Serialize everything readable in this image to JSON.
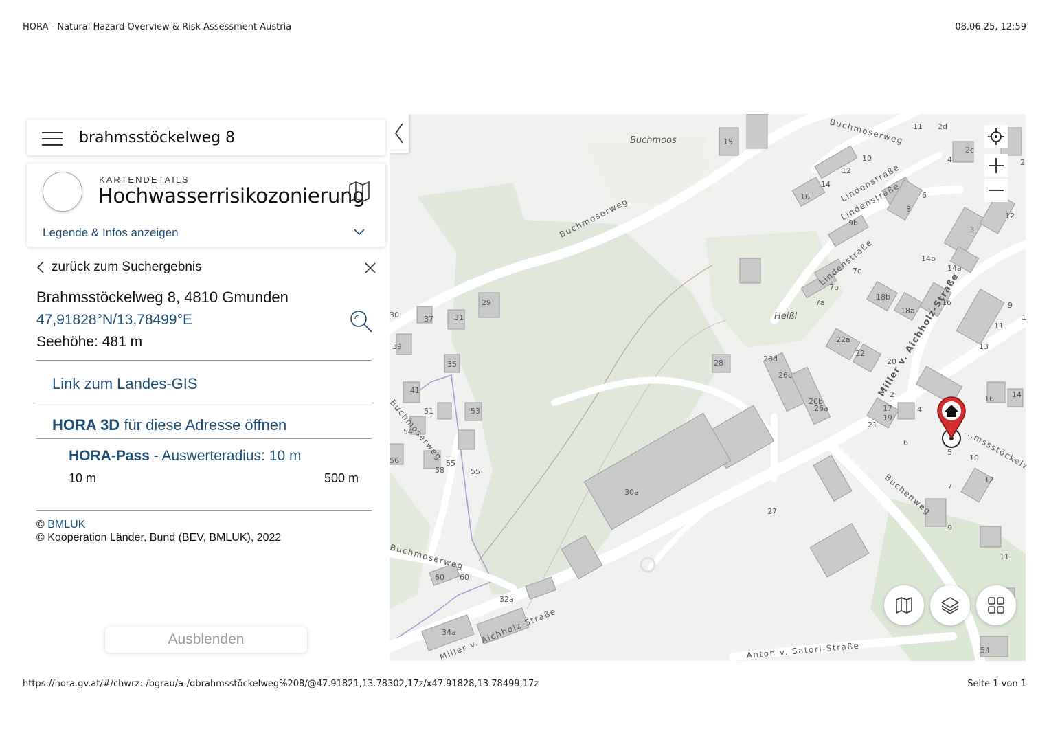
{
  "print_header": {
    "title": "HORA - Natural Hazard Overview & Risk Assessment Austria",
    "datetime": "08.06.25, 12:59"
  },
  "print_footer": {
    "url": "https://hora.gv.at/#/chwrz:-/bgrau/a-/qbrahmsstöckelweg%208/@47.91821,13.78302,17z/x47.91828,13.78499,17z",
    "page": "Seite 1 von 1"
  },
  "search": {
    "value": "brahmsstöckelweg 8"
  },
  "card": {
    "kicker": "KARTENDETAILS",
    "title": "Hochwasserrisikozonierung",
    "legend_label": "Legende & Infos anzeigen"
  },
  "result": {
    "back_label": "zurück zum Suchergebnis",
    "address": "Brahmsstöckelweg 8, 4810 Gmunden",
    "coords": "47,91828°N/13,78499°E",
    "altitude": "Seehöhe: 481 m",
    "landes_gis_link": "Link zum Landes-GIS",
    "hora3d_bold": "HORA 3D",
    "hora3d_rest": " für diese Adresse öffnen",
    "pass_bold": "HORA-Pass",
    "pass_rest": " - Auswerteradius: 10 m",
    "range_min": "10 m",
    "range_max": "500 m"
  },
  "credits": {
    "line1_prefix": "© ",
    "line1_link": "BMLUK",
    "line2": "© Kooperation Länder, Bund (BEV, BMLUK), 2022"
  },
  "hide_button": "Ausblenden",
  "map": {
    "street_labels": [
      "Buchmoserweg",
      "Buchmoserweg",
      "Buchmoserweg",
      "Lindenstraße",
      "Lindenstraße",
      "Lindenstraße",
      "Miller v. Aichholz-Straße",
      "Buchenweg",
      "Miller v. Aichholz-Straße",
      "Anton v. Satori-Straße",
      "...mssstöckelweg",
      "Buchmoserweg"
    ],
    "place_labels": [
      "Buchmoos",
      "Heißl"
    ],
    "house_numbers": [
      "15",
      "11",
      "2d",
      "10",
      "12",
      "14",
      "16",
      "4",
      "2c",
      "2",
      "8",
      "6",
      "9b",
      "3",
      "12",
      "11",
      "14b",
      "14a",
      "7c",
      "7b",
      "7a",
      "18b",
      "18a",
      "16",
      "9",
      "11",
      "13",
      "29",
      "31",
      "37",
      "30",
      "39",
      "35",
      "41",
      "28",
      "26d",
      "26c",
      "26b",
      "26a",
      "22a",
      "22",
      "20",
      "2",
      "17",
      "19",
      "21",
      "4",
      "16",
      "14",
      "6",
      "5",
      "10",
      "12",
      "7",
      "9",
      "11",
      "51",
      "53",
      "54",
      "56",
      "58",
      "55",
      "55",
      "30a",
      "27",
      "60",
      "60",
      "32a",
      "34a",
      "54"
    ],
    "icons": [
      "locate-icon",
      "zoom-in-icon",
      "zoom-out-icon",
      "home-marker-icon",
      "basemap-icon",
      "layers-icon",
      "grid-icon"
    ]
  }
}
